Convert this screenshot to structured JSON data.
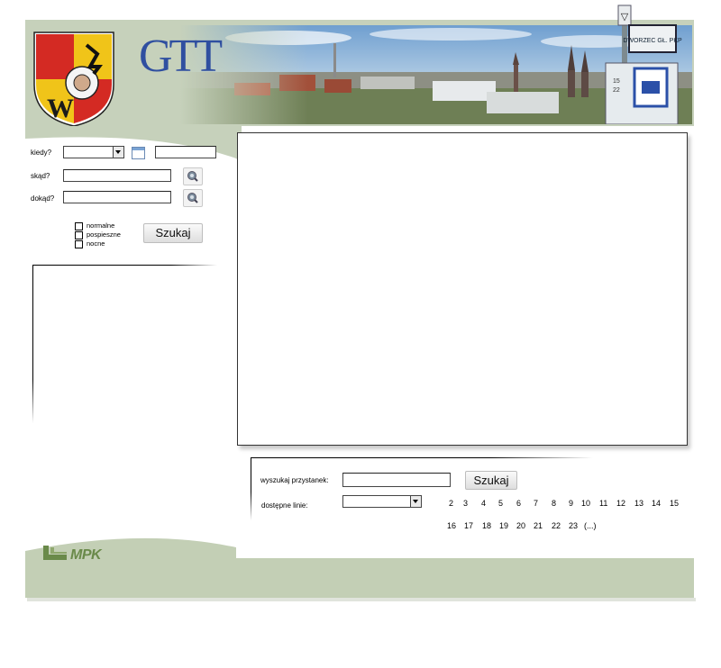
{
  "header": {
    "logo_text": "GTT",
    "sign_text": "DWORZEC GŁ. PKP",
    "sign_numbers": "15\n22"
  },
  "search": {
    "when_label": "kiedy?",
    "from_label": "skąd?",
    "to_label": "dokąd?",
    "when_select_value": "",
    "when_time_value": "",
    "from_value": "",
    "to_value": "",
    "submit_label": "Szukaj",
    "options": [
      {
        "label": "normalne"
      },
      {
        "label": "pospieszne"
      },
      {
        "label": "nocne"
      }
    ]
  },
  "stop_search": {
    "label": "wyszukaj przystanek:",
    "value": "",
    "submit_label": "Szukaj",
    "lines_label": "dostępne linie:",
    "lines_select_value": "",
    "lines_row1": [
      "2",
      "3",
      "4",
      "5",
      "6",
      "7",
      "8",
      "9",
      "10",
      "11",
      "12",
      "13",
      "14",
      "15"
    ],
    "lines_row2": [
      "16",
      "17",
      "18",
      "19",
      "20",
      "21",
      "22",
      "23",
      "(...)"
    ]
  },
  "footer": {
    "brand_text": "MPK"
  },
  "colors": {
    "header_green": "#c6d1bb",
    "footer_green": "#c3cfb5",
    "brand_green": "#6a8a4a"
  }
}
